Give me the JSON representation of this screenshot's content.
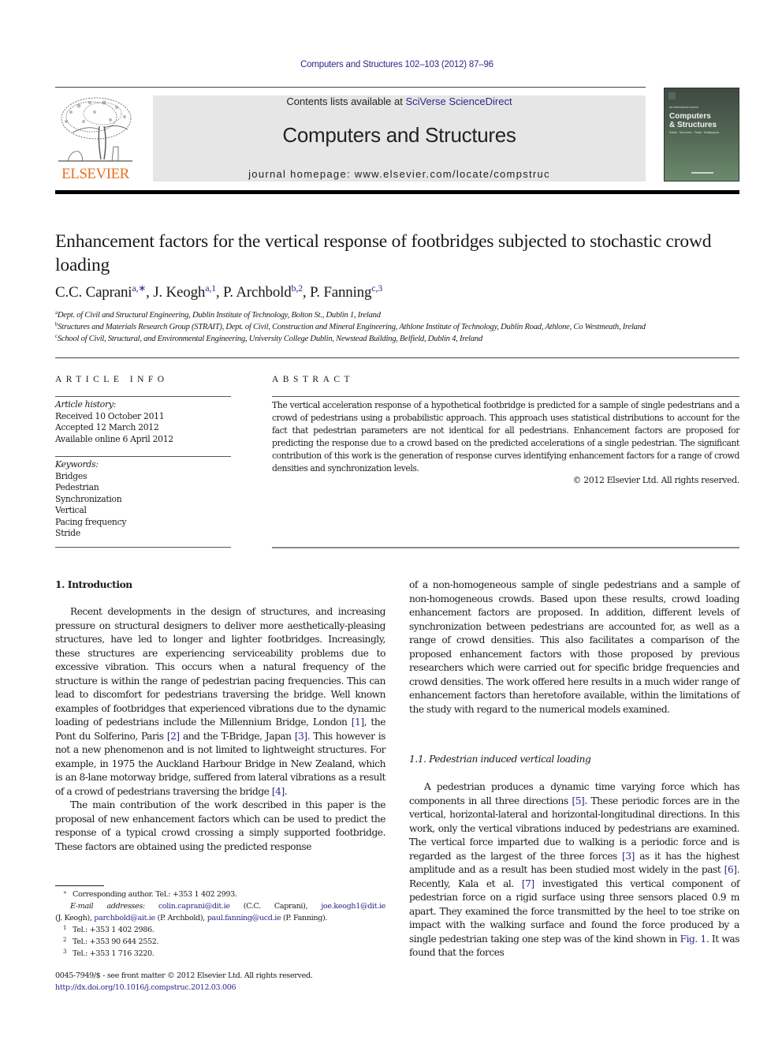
{
  "journal_ref": "Computers and Structures 102–103 (2012) 87–96",
  "header": {
    "contents_prefix": "Contents lists available at ",
    "contents_link": "SciVerse ScienceDirect",
    "journal_name": "Computers and Structures",
    "homepage": "journal homepage: www.elsevier.com/locate/compstruc",
    "publisher_logo_text": "ELSEVIER",
    "publisher_color": "#e9711c",
    "cover": {
      "kicker": "An International Journal",
      "title_line1": "Computers",
      "title_line2": "& Structures",
      "subtitle": "Solids · Structures · Fluids · Multiphysics"
    }
  },
  "article": {
    "title": "Enhancement factors for the vertical response of footbridges subjected to stochastic crowd loading",
    "authors": [
      {
        "name": "C.C. Caprani",
        "sup": "a,∗",
        "sep": ", "
      },
      {
        "name": "J. Keogh",
        "sup": "a,1",
        "sep": ", "
      },
      {
        "name": "P. Archbold",
        "sup": "b,2",
        "sep": ", "
      },
      {
        "name": "P. Fanning",
        "sup": "c,3",
        "sep": ""
      }
    ],
    "affiliations": [
      {
        "key": "a",
        "text": "Dept. of Civil and Structural Engineering, Dublin Institute of Technology, Bolton St., Dublin 1, Ireland"
      },
      {
        "key": "b",
        "text": "Structures and Materials Research Group (STRAIT), Dept. of Civil, Construction and Mineral Engineering, Athlone Institute of Technology, Dublin Road, Athlone, Co Westmeath, Ireland"
      },
      {
        "key": "c",
        "text": "School of Civil, Structural, and Environmental Engineering, University College Dublin, Newstead Building, Belfield, Dublin 4, Ireland"
      }
    ]
  },
  "article_info": {
    "heading": "ARTICLE INFO",
    "history_label": "Article history:",
    "history": [
      "Received 10 October 2011",
      "Accepted 12 March 2012",
      "Available online 6 April 2012"
    ],
    "keywords_label": "Keywords:",
    "keywords": [
      "Bridges",
      "Pedestrian",
      "Synchronization",
      "Vertical",
      "Pacing frequency",
      "Stride"
    ]
  },
  "abstract": {
    "heading": "ABSTRACT",
    "text": "The vertical acceleration response of a hypothetical footbridge is predicted for a sample of single pedestrians and a crowd of pedestrians using a probabilistic approach. This approach uses statistical distributions to account for the fact that pedestrian parameters are not identical for all pedestrians. Enhancement factors are proposed for predicting the response due to a crowd based on the predicted accelerations of a single pedestrian. The significant contribution of this work is the generation of response curves identifying enhancement factors for a range of crowd densities and synchronization levels.",
    "copyright": "© 2012 Elsevier Ltd. All rights reserved."
  },
  "body": {
    "section1_heading": "1. Introduction",
    "intro_p1": [
      {
        "t": "Recent developments in the design of structures, and increasing pressure on structural designers to deliver more aesthetically-pleasing structures, have led to longer and lighter footbridges. Increasingly, these structures are experiencing serviceability problems due to excessive vibration. This occurs when a natural frequency of the structure is within the range of pedestrian pacing frequencies. This can lead to discomfort for pedestrians traversing the bridge. Well known examples of footbridges that experienced vibrations due to the dynamic loading of pedestrians include the Millennium Bridge, London "
      },
      {
        "ref": "[1]"
      },
      {
        "t": ", the Pont du Solferino, Paris "
      },
      {
        "ref": "[2]"
      },
      {
        "t": " and the T-Bridge, Japan "
      },
      {
        "ref": "[3]"
      },
      {
        "t": ". This however is not a new phenomenon and is not limited to lightweight structures. For example, in 1975 the Auckland Harbour Bridge in New Zealand, which is an 8-lane motorway bridge, suffered from lateral vibrations as a result of a crowd of pedestrians traversing the bridge "
      },
      {
        "ref": "[4]"
      },
      {
        "t": "."
      }
    ],
    "intro_p2": "The main contribution of the work described in this paper is the proposal of new enhancement factors which can be used to predict the response of a typical crowd crossing a simply supported footbridge. These factors are obtained using the predicted response",
    "right_p1": "of a non-homogeneous sample of single pedestrians and a sample of non-homogeneous crowds. Based upon these results, crowd loading enhancement factors are proposed. In addition, different levels of synchronization between pedestrians are accounted for, as well as a range of crowd densities. This also facilitates a comparison of the proposed enhancement factors with those proposed by previous researchers which were carried out for specific bridge frequencies and crowd densities. The work offered here results in a much wider range of enhancement factors than heretofore available, within the limitations of the study with regard to the numerical models examined.",
    "section11_heading": "1.1. Pedestrian induced vertical loading",
    "sec11_p1": [
      {
        "t": "A pedestrian produces a dynamic time varying force which has components in all three directions "
      },
      {
        "ref": "[5]"
      },
      {
        "t": ". These periodic forces are in the vertical, horizontal-lateral and horizontal-longitudinal directions. In this work, only the vertical vibrations induced by pedestrians are examined. The vertical force imparted due to walking is a periodic force and is regarded as the largest of the three forces "
      },
      {
        "ref": "[3]"
      },
      {
        "t": " as it has the highest amplitude and as a result has been studied most widely in the past "
      },
      {
        "ref": "[6]"
      },
      {
        "t": ". Recently, Kala et al. "
      },
      {
        "ref": "[7]"
      },
      {
        "t": " investigated this vertical component of pedestrian force on a rigid surface using three sensors placed 0.9 m apart. They examined the force transmitted by the heel to toe strike on impact with the walking surface and found the force produced by a single pedestrian taking one step was of the kind shown in "
      },
      {
        "ref": "Fig. 1"
      },
      {
        "t": ". It was found that the forces"
      }
    ]
  },
  "footnotes": {
    "corresponding": {
      "mark": "∗",
      "text": "Corresponding author. Tel.: +353 1 402 2993."
    },
    "email_label": "E-mail addresses:",
    "emails": [
      {
        "email": "colin.caprani@dit.ie",
        "who": "(C.C. Caprani)"
      },
      {
        "email": "joe.keogh1@dit.ie",
        "who": "(J. Keogh)"
      },
      {
        "email": "parchbold@ait.ie",
        "who": "(P. Archbold)"
      },
      {
        "email": "paul.fanning@ucd.ie",
        "who": "(P. Fanning)."
      }
    ],
    "phones": [
      {
        "mark": "1",
        "text": "Tel.: +353 1 402 2986."
      },
      {
        "mark": "2",
        "text": "Tel.: +353 90 644 2552."
      },
      {
        "mark": "3",
        "text": "Tel.: +353 1 716 3220."
      }
    ],
    "front_matter": "0045-7949/$ - see front matter © 2012 Elsevier Ltd. All rights reserved.",
    "doi": "http://dx.doi.org/10.1016/j.compstruc.2012.03.006"
  },
  "colors": {
    "link": "#2a2a8a",
    "header_box": "#e6e6e6",
    "rule": "#000000"
  }
}
